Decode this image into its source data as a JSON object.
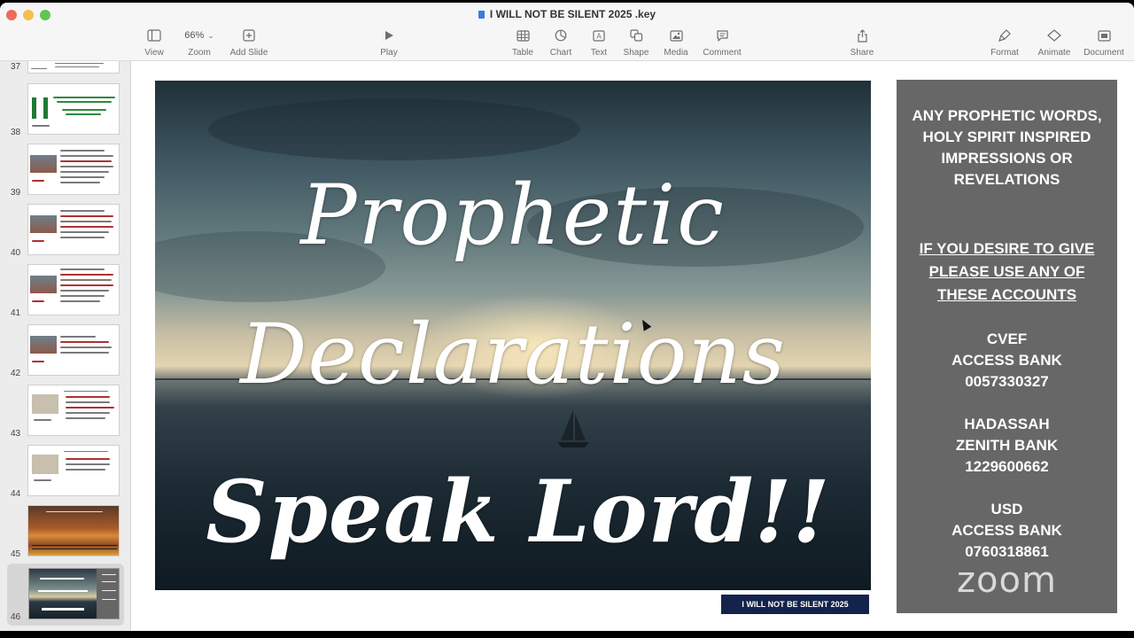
{
  "window": {
    "title": "I WILL NOT BE SILENT 2025  .key"
  },
  "toolbar": {
    "view_label": "View",
    "zoom_value": "66%",
    "zoom_label": "Zoom",
    "add_slide_label": "Add Slide",
    "play_label": "Play",
    "table_label": "Table",
    "chart_label": "Chart",
    "text_label": "Text",
    "shape_label": "Shape",
    "media_label": "Media",
    "comment_label": "Comment",
    "share_label": "Share",
    "format_label": "Format",
    "animate_label": "Animate",
    "document_label": "Document"
  },
  "sidebar": {
    "slides": [
      {
        "number": "37"
      },
      {
        "number": "38"
      },
      {
        "number": "39"
      },
      {
        "number": "40"
      },
      {
        "number": "41"
      },
      {
        "number": "42"
      },
      {
        "number": "43"
      },
      {
        "number": "44"
      },
      {
        "number": "45"
      },
      {
        "number": "46"
      }
    ],
    "selected": "46"
  },
  "slide": {
    "line1": "Prophetic",
    "line2": "Declarations",
    "line3": "Speak Lord!!",
    "banner": "I WILL NOT BE SILENT 2025"
  },
  "panel": {
    "prophetic": [
      "ANY PROPHETIC WORDS,",
      "HOLY SPIRIT INSPIRED",
      "IMPRESSIONS OR",
      "REVELATIONS"
    ],
    "give": [
      "IF YOU DESIRE TO GIVE",
      "PLEASE USE ANY OF",
      "THESE ACCOUNTS"
    ],
    "account1": [
      "CVEF",
      "ACCESS BANK",
      "0057330327"
    ],
    "account2": [
      "HADASSAH",
      "ZENITH BANK",
      "1229600662"
    ],
    "account3": [
      "USD",
      "ACCESS BANK",
      "0760318861"
    ],
    "logo": "zoom"
  },
  "colors": {
    "banner_bg": "#14234c",
    "panel_bg": "#676767"
  }
}
